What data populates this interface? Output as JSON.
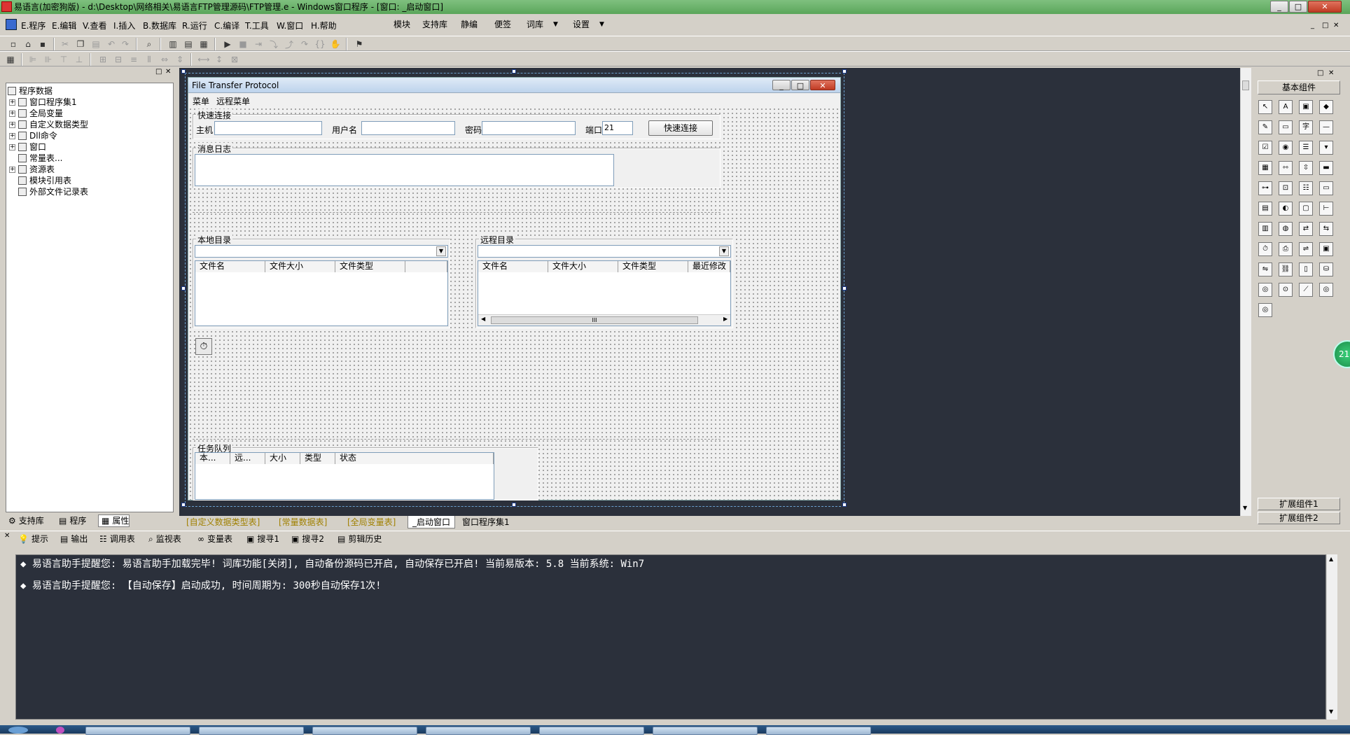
{
  "window": {
    "title": "易语言(加密狗版) - d:\\Desktop\\网络相关\\易语言FTP管理源码\\FTP管理.e - Windows窗口程序 - [窗口: _启动窗口]"
  },
  "menu": {
    "items": [
      "E.程序",
      "E.编辑",
      "V.查看",
      "I.插入",
      "B.数据库",
      "R.运行",
      "C.编译",
      "T.工具",
      "W.窗口",
      "H.帮助"
    ],
    "right_items": [
      "模块",
      "支持库",
      "静编",
      "便签",
      "词库",
      "设置"
    ]
  },
  "tree": {
    "root": "程序数据",
    "items": [
      "窗口程序集1",
      "全局变量",
      "自定义数据类型",
      "Dll命令",
      "窗口",
      "常量表...",
      "资源表",
      "模块引用表",
      "外部文件记录表"
    ]
  },
  "left_tabs": [
    "支持库",
    "程序",
    "属性"
  ],
  "designer": {
    "form_title": "File Transfer Protocol",
    "form_menu": [
      "菜单",
      "远程菜单"
    ],
    "quick_connect": {
      "title": "快速连接",
      "host_label": "主机",
      "user_label": "用户名",
      "password_label": "密码",
      "port_label": "端口",
      "port_value": "21",
      "connect_button": "快速连接"
    },
    "log_title": "消息日志",
    "local_dir": {
      "title": "本地目录",
      "columns": [
        "文件名",
        "文件大小",
        "文件类型",
        ""
      ]
    },
    "remote_dir": {
      "title": "远程目录",
      "columns": [
        "文件名",
        "文件大小",
        "文件类型",
        "最近修改"
      ],
      "scroll_thumb": "III"
    },
    "queue": {
      "title": "任务队列",
      "columns": [
        "本...",
        "远...",
        "大小",
        "类型",
        "状态"
      ]
    }
  },
  "editor_tabs": [
    "[自定义数据类型表]",
    "[常量数据表]",
    "[全局变量表]",
    "_启动窗口",
    "窗口程序集1"
  ],
  "components": {
    "title": "基本组件",
    "ext1": "扩展组件1",
    "ext2": "扩展组件2",
    "icons": [
      "pointer-icon",
      "label-icon",
      "picture-icon",
      "shape-icon",
      "edit-icon",
      "frame-icon",
      "font-icon",
      "line-icon",
      "checkbox-icon",
      "radio-icon",
      "list-icon",
      "combo-icon",
      "grid-icon",
      "scroll-h-icon",
      "scroll-v-icon",
      "progress-icon",
      "slider-icon",
      "tab-icon",
      "toolbar-icon",
      "status-icon",
      "calendar-icon",
      "color-icon",
      "folder-icon",
      "tree-icon",
      "table-icon",
      "db-icon",
      "arrange-icon",
      "chart-icon",
      "timer-icon",
      "printer-icon",
      "network-icon",
      "server-icon",
      "client-icon",
      "link-icon",
      "window-icon",
      "data-icon",
      "odbc-icon",
      "db-provider-icon",
      "graph-icon",
      "odbc2-icon",
      "odbc3-icon"
    ]
  },
  "output_tabs": [
    "提示",
    "输出",
    "调用表",
    "监视表",
    "变量表",
    "搜寻1",
    "搜寻2",
    "剪辑历史"
  ],
  "output": {
    "lines": [
      "易语言助手提醒您:  易语言助手加载完毕! 词库功能[关闭], 自动备份源码已开启, 自动保存已开启! 当前易版本: 5.8  当前系统: Win7",
      "易语言助手提醒您: 【自动保存】启动成功, 时间周期为: 300秒自动保存1次!"
    ]
  },
  "float_badge": "21"
}
